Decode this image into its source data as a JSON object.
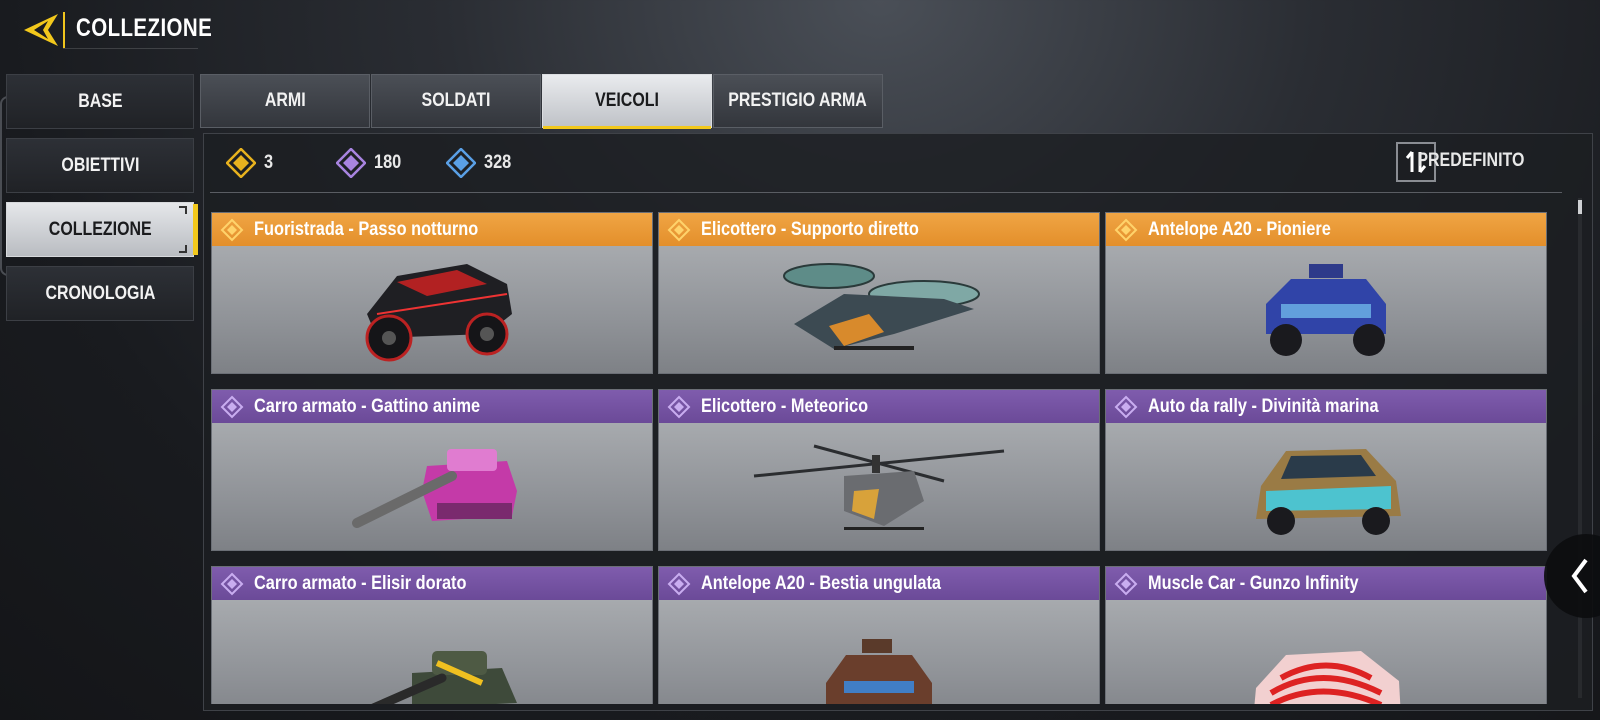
{
  "header": {
    "title": "COLLEZIONE",
    "back_icon": "back-arrow-icon"
  },
  "side_nav": {
    "items": [
      {
        "label": "BASE",
        "active": false
      },
      {
        "label": "OBIETTIVI",
        "active": false
      },
      {
        "label": "COLLEZIONE",
        "active": true
      },
      {
        "label": "CRONOLOGIA",
        "active": false
      }
    ]
  },
  "tabs": [
    {
      "label": "ARMI",
      "active": false
    },
    {
      "label": "SOLDATI",
      "active": false
    },
    {
      "label": "VEICOLI",
      "active": true
    },
    {
      "label": "PRESTIGIO ARMA",
      "active": false
    }
  ],
  "currencies": [
    {
      "icon": "legendary-gem-icon",
      "value": "3",
      "color": "#e8b21e"
    },
    {
      "icon": "epic-gem-icon",
      "value": "180",
      "color": "#a884e0"
    },
    {
      "icon": "rare-gem-icon",
      "value": "328",
      "color": "#5aa0e6"
    }
  ],
  "sort": {
    "label": "PREDEFINITO",
    "icon": "sort-arrows-icon"
  },
  "colors": {
    "accent": "#f2c81c",
    "legendary": "#e8952f",
    "epic": "#7452a2"
  },
  "cards": [
    {
      "name": "Fuoristrada - Passo notturno",
      "rarity": "legendary",
      "vehicle": "buggy"
    },
    {
      "name": "Elicottero - Supporto diretto",
      "rarity": "legendary",
      "vehicle": "vtol"
    },
    {
      "name": "Antelope A20 - Pioniere",
      "rarity": "legendary",
      "vehicle": "jeep"
    },
    {
      "name": "Carro armato - Gattino anime",
      "rarity": "epic",
      "vehicle": "tank"
    },
    {
      "name": "Elicottero - Meteorico",
      "rarity": "epic",
      "vehicle": "helicopter"
    },
    {
      "name": "Auto da rally - Divinità marina",
      "rarity": "epic",
      "vehicle": "rally"
    },
    {
      "name": "Carro armato - Elisir dorato",
      "rarity": "epic",
      "vehicle": "tank"
    },
    {
      "name": "Antelope A20 - Bestia ungulata",
      "rarity": "epic",
      "vehicle": "jeep"
    },
    {
      "name": "Muscle Car - Gunzo Infinity",
      "rarity": "epic",
      "vehicle": "car"
    }
  ],
  "collapse_icon": "chevron-left-icon"
}
